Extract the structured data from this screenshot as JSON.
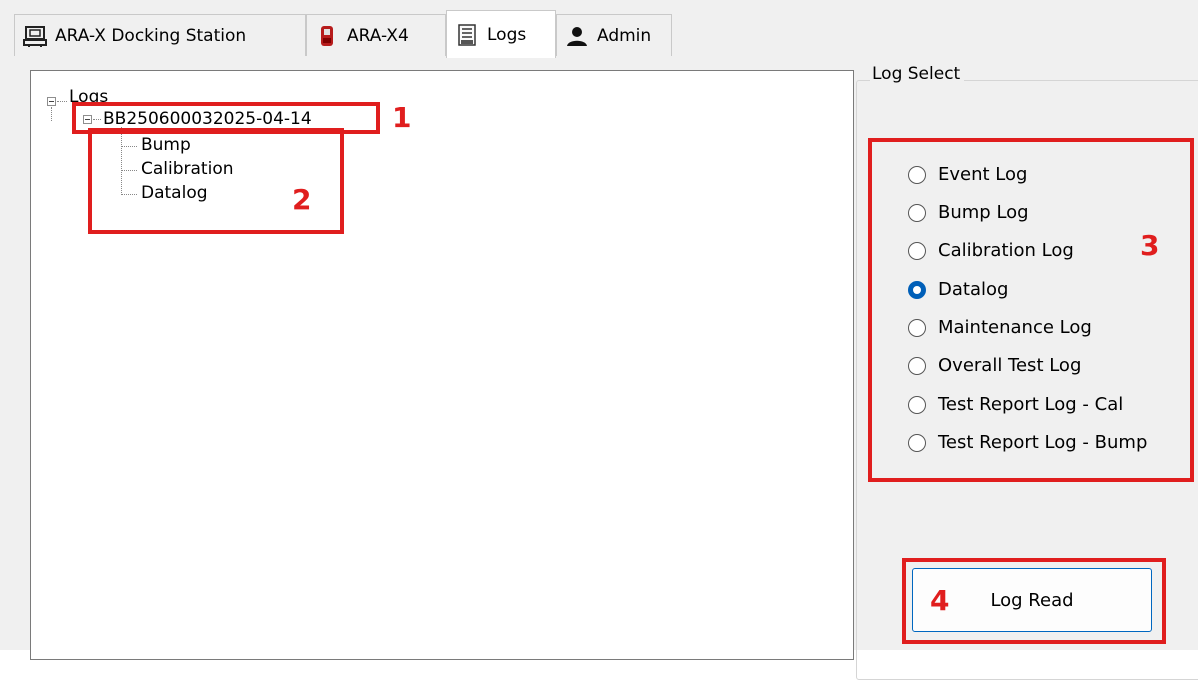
{
  "tabs": [
    {
      "label": "ARA-X Docking Station",
      "icon": "docking-station-icon"
    },
    {
      "label": "ARA-X4",
      "icon": "gas-detector-icon"
    },
    {
      "label": "Logs",
      "icon": "logs-icon",
      "active": true
    },
    {
      "label": "Admin",
      "icon": "user-icon"
    }
  ],
  "tree": {
    "root": "Logs",
    "device": "BB250600032025-04-14",
    "children": [
      "Bump",
      "Calibration",
      "Datalog"
    ]
  },
  "log_select": {
    "title": "Log Select",
    "options": [
      "Event Log",
      "Bump Log",
      "Calibration Log",
      "Datalog",
      "Maintenance Log",
      "Overall Test Log",
      "Test Report Log - Cal",
      "Test Report Log - Bump"
    ],
    "selected": "Datalog"
  },
  "button": {
    "label": "Log Read"
  },
  "annotations": [
    "1",
    "2",
    "3",
    "4"
  ],
  "colors": {
    "annotation": "#e01e1e",
    "radio_selected": "#005fb8"
  }
}
